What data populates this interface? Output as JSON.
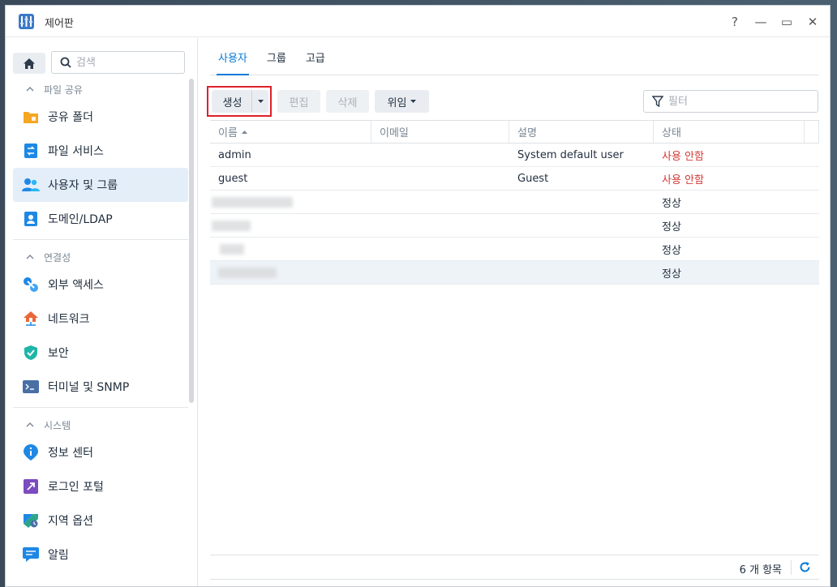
{
  "window": {
    "title": "제어판"
  },
  "window_controls": [
    {
      "name": "help-button",
      "glyph": "?"
    },
    {
      "name": "minimize-button",
      "glyph": "—"
    },
    {
      "name": "maximize-button",
      "glyph": "▭"
    },
    {
      "name": "close-button",
      "glyph": "✕"
    }
  ],
  "sidebar": {
    "search_placeholder": "검색",
    "sections": [
      {
        "title": "파일 공유",
        "items": [
          {
            "label": "공유 폴더",
            "icon": "folder-icon",
            "color": "#f5a623"
          },
          {
            "label": "파일 서비스",
            "icon": "file-services-icon",
            "color": "#1e88e5"
          },
          {
            "label": "사용자 및 그룹",
            "icon": "users-icon",
            "color": "#1e88e5",
            "active": true
          },
          {
            "label": "도메인/LDAP",
            "icon": "domain-icon",
            "color": "#1e88e5"
          }
        ]
      },
      {
        "title": "연결성",
        "items": [
          {
            "label": "외부 액세스",
            "icon": "external-access-icon",
            "color": "#1e88e5"
          },
          {
            "label": "네트워크",
            "icon": "network-icon",
            "color": "#e8683a"
          },
          {
            "label": "보안",
            "icon": "security-shield-icon",
            "color": "#1fb5a8"
          },
          {
            "label": "터미널 및 SNMP",
            "icon": "terminal-icon",
            "color": "#4a6fa5"
          }
        ]
      },
      {
        "title": "시스템",
        "items": [
          {
            "label": "정보 센터",
            "icon": "info-icon",
            "color": "#1e88e5"
          },
          {
            "label": "로그인 포털",
            "icon": "login-portal-icon",
            "color": "#7b4bbf"
          },
          {
            "label": "지역 옵션",
            "icon": "regional-options-icon",
            "color": "#2aa58a"
          },
          {
            "label": "알림",
            "icon": "notification-icon",
            "color": "#1e88e5"
          }
        ]
      }
    ]
  },
  "tabs": [
    {
      "label": "사용자",
      "active": true
    },
    {
      "label": "그룹",
      "active": false
    },
    {
      "label": "고급",
      "active": false
    }
  ],
  "toolbar": {
    "create_label": "생성",
    "edit_label": "편집",
    "delete_label": "삭제",
    "delegate_label": "위임",
    "filter_placeholder": "필터"
  },
  "table": {
    "columns": [
      "이름",
      "이메일",
      "설명",
      "상태"
    ],
    "rows": [
      {
        "name": "admin",
        "email": "",
        "description": "System default user",
        "status": "사용 안함",
        "status_type": "disabled"
      },
      {
        "name": "guest",
        "email": "",
        "description": "Guest",
        "status": "사용 안함",
        "status_type": "disabled"
      },
      {
        "name": "",
        "email": "",
        "description": "",
        "status": "정상",
        "status_type": "normal",
        "redacted": true
      },
      {
        "name": "",
        "email": "",
        "description": "",
        "status": "정상",
        "status_type": "normal",
        "redacted": true
      },
      {
        "name": "",
        "email": "",
        "description": "",
        "status": "정상",
        "status_type": "normal",
        "redacted": true
      },
      {
        "name": "",
        "email": "",
        "description": "",
        "status": "정상",
        "status_type": "normal",
        "redacted": true,
        "selected": true
      }
    ]
  },
  "footer": {
    "count_text": "6 개 항목"
  },
  "colors": {
    "accent": "#0a7ad6",
    "disabled_status": "#d23a36",
    "highlight_box": "#e0202a"
  }
}
